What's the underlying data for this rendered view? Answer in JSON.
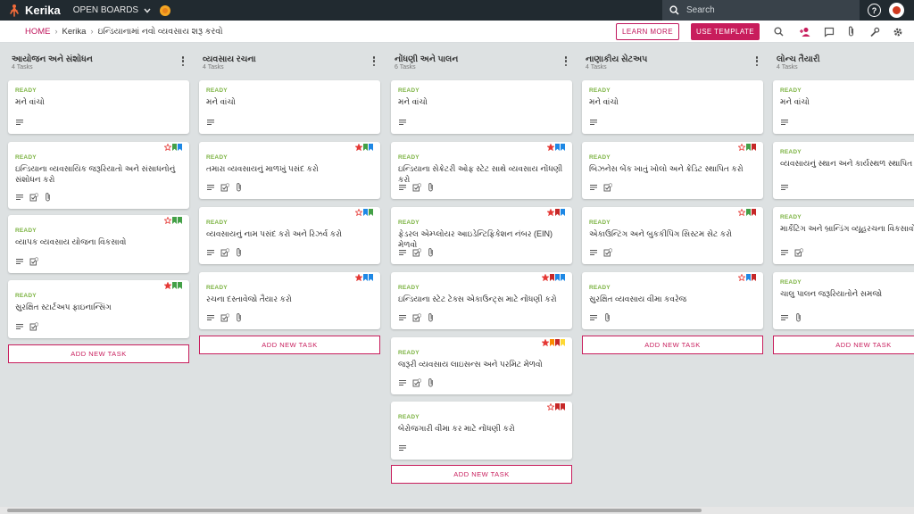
{
  "app": {
    "name": "Kerika",
    "open_boards": "OPEN BOARDS",
    "search_placeholder": "Search"
  },
  "breadcrumb": {
    "home": "HOME",
    "account": "Kerika",
    "board": "ઇન્ડિયાનામાં નવો વ્યવસાય શરૂ કરવો"
  },
  "toolbar": {
    "learn_more": "LEARN MORE",
    "use_template": "USE TEMPLATE"
  },
  "colors": {
    "accent": "#c81d5c",
    "ready": "#7cb342",
    "red": "#e53935",
    "green": "#43a047",
    "blue": "#1e88e5",
    "dark_red": "#c62828",
    "orange": "#fb8c00",
    "yellow": "#fdd835",
    "topbar": "#212a30"
  },
  "add_task_label": "ADD NEW TASK",
  "columns": [
    {
      "title": "આયોજન અને સંશોધન",
      "count": "4 Tasks",
      "cards": [
        {
          "status": "READY",
          "title": "મને વાંચો",
          "stars": "",
          "flags": [],
          "icons": [
            "desc"
          ]
        },
        {
          "status": "READY",
          "title": "ઇન્ડિયાના વ્યવસાયિક જરૂરિયાતો અને સંસાધનોનું સંશોધન કરો",
          "stars": "outline",
          "flags": [
            "green",
            "blue"
          ],
          "icons": [
            "desc",
            "check",
            "clip"
          ]
        },
        {
          "status": "READY",
          "title": "વ્યાપક વ્યવસાય યોજના વિકસાવો",
          "stars": "outline",
          "flags": [
            "green",
            "green"
          ],
          "icons": [
            "desc",
            "check"
          ]
        },
        {
          "status": "READY",
          "title": "સુરક્ષિત સ્ટાર્ટઅપ ફાઇનાન્સિંગ",
          "stars": "filled",
          "flags": [
            "green",
            "green"
          ],
          "icons": [
            "desc",
            "check"
          ]
        }
      ]
    },
    {
      "title": "વ્યવસાય રચના",
      "count": "4 Tasks",
      "cards": [
        {
          "status": "READY",
          "title": "મને વાંચો",
          "stars": "",
          "flags": [],
          "icons": [
            "desc"
          ]
        },
        {
          "status": "READY",
          "title": "તમારા વ્યવસાયનું માળખું પસંદ કરો",
          "stars": "filled",
          "flags": [
            "green",
            "blue"
          ],
          "icons": [
            "desc",
            "check",
            "clip"
          ]
        },
        {
          "status": "READY",
          "title": "વ્યવસાયનું નામ પસંદ કરો અને રિઝર્વ કરો",
          "stars": "outline",
          "flags": [
            "blue",
            "green"
          ],
          "icons": [
            "desc",
            "check",
            "clip"
          ]
        },
        {
          "status": "READY",
          "title": "રચના દસ્તાવેજો તૈયાર કરો",
          "stars": "filled",
          "flags": [
            "blue",
            "blue"
          ],
          "icons": [
            "desc",
            "check",
            "clip"
          ]
        }
      ]
    },
    {
      "title": "નોંધણી અને પાલન",
      "count": "6 Tasks",
      "cards": [
        {
          "status": "READY",
          "title": "મને વાંચો",
          "stars": "",
          "flags": [],
          "icons": [
            "desc"
          ]
        },
        {
          "status": "READY",
          "title": "ઇન્ડિયાના સેક્રેટરી ઓફ સ્ટેટ સાથે વ્યવસાય નોંધણી કરો",
          "stars": "filled",
          "flags": [
            "blue",
            "blue"
          ],
          "icons": [
            "desc",
            "check",
            "clip"
          ]
        },
        {
          "status": "READY",
          "title": "ફેડરલ એમ્પ્લોયર આઇડેન્ટિફિકેશન નંબર (EIN) મેળવો",
          "stars": "filled",
          "flags": [
            "dark_red",
            "blue"
          ],
          "icons": [
            "desc",
            "check",
            "clip"
          ]
        },
        {
          "status": "READY",
          "title": "ઇન્ડિયાના સ્ટેટ ટેક્સ એકાઉન્ટ્સ માટે નોંધણી કરો",
          "stars": "filled",
          "flags": [
            "dark_red",
            "blue",
            "blue"
          ],
          "icons": [
            "desc",
            "check",
            "clip"
          ]
        },
        {
          "status": "READY",
          "title": "જરૂરી વ્યવસાય લાઇસન્સ અને પરમિટ મેળવો",
          "stars": "filled",
          "flags": [
            "orange",
            "dark_red",
            "yellow"
          ],
          "icons": [
            "desc",
            "check",
            "clip"
          ]
        },
        {
          "status": "READY",
          "title": "બેરોજગારી વીમા કર માટે નોંધણી કરો",
          "stars": "outline",
          "flags": [
            "dark_red",
            "dark_red"
          ],
          "icons": [
            "desc"
          ]
        }
      ]
    },
    {
      "title": "નાણાકીય સેટઅપ",
      "count": "4 Tasks",
      "cards": [
        {
          "status": "READY",
          "title": "મને વાંચો",
          "stars": "",
          "flags": [],
          "icons": [
            "desc"
          ]
        },
        {
          "status": "READY",
          "title": "બિઝનેસ બેંક ખાતું ખોલો અને ક્રેડિટ સ્થાપિત કરો",
          "stars": "outline",
          "flags": [
            "green",
            "dark_red"
          ],
          "icons": [
            "desc",
            "check"
          ]
        },
        {
          "status": "READY",
          "title": "એકાઉન્ટિંગ અને બુકકીપિંગ સિસ્ટમ સેટ કરો",
          "stars": "outline",
          "flags": [
            "green",
            "dark_red"
          ],
          "icons": [
            "desc",
            "check"
          ]
        },
        {
          "status": "READY",
          "title": "સુરક્ષિત વ્યવસાય વીમા કવરેજ",
          "stars": "outline",
          "flags": [
            "blue",
            "dark_red"
          ],
          "icons": [
            "desc",
            "clip"
          ]
        }
      ]
    },
    {
      "title": "લોન્ચ તૈયારી",
      "count": "4 Tasks",
      "cards": [
        {
          "status": "READY",
          "title": "મને વાંચો",
          "stars": "",
          "flags": [],
          "icons": [
            "desc"
          ]
        },
        {
          "status": "READY",
          "title": "વ્યવસાયનું સ્થાન અને કાર્યસ્થળ સ્થાપિત કરો",
          "stars": "",
          "flags": [],
          "icons": [
            "desc"
          ]
        },
        {
          "status": "READY",
          "title": "માર્કેટિંગ અને બ્રાન્ડિંગ વ્યૂહરચના વિકસાવો",
          "stars": "",
          "flags": [],
          "icons": [
            "desc",
            "check"
          ]
        },
        {
          "status": "READY",
          "title": "ચાલુ પાલન જરૂરિયાતોને સમજો",
          "stars": "",
          "flags": [],
          "icons": [
            "desc",
            "clip"
          ]
        }
      ]
    }
  ]
}
